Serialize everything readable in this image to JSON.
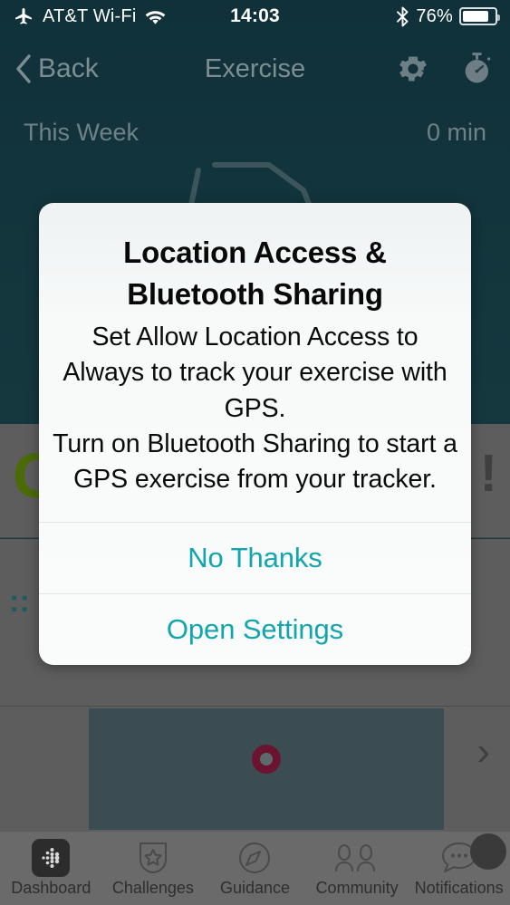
{
  "statusbar": {
    "airplane_icon": "airplane-icon",
    "carrier": "AT&T Wi-Fi",
    "wifi_icon": "wifi-icon",
    "time": "14:03",
    "bluetooth_icon": "bluetooth-icon",
    "battery_percent": "76%",
    "battery_icon": "battery-icon"
  },
  "navbar": {
    "back_label": "Back",
    "back_icon": "chevron-left-icon",
    "title": "Exercise",
    "settings_icon": "gear-icon",
    "stopwatch_icon": "stopwatch-icon"
  },
  "summary": {
    "period_label": "This Week",
    "duration_value": "0 min"
  },
  "background": {
    "green_glyph": "G",
    "exclamation": "!",
    "teal_fragment": "::",
    "chevron": "›",
    "record_icon": "record-button-icon",
    "shoe_icon": "running-shoe-icon"
  },
  "dialog": {
    "title": "Location Access & Bluetooth Sharing",
    "message": "Set Allow Location Access to Always to track your exercise with GPS.\nTurn on Bluetooth Sharing to start a GPS exercise from your tracker.",
    "primary_label": "Open Settings",
    "secondary_label": "No Thanks",
    "accent_color": "#12a5ad"
  },
  "tabbar": {
    "items": [
      {
        "label": "Dashboard",
        "icon": "fitbit-dots-icon"
      },
      {
        "label": "Challenges",
        "icon": "shield-star-icon"
      },
      {
        "label": "Guidance",
        "icon": "compass-icon"
      },
      {
        "label": "Community",
        "icon": "people-icon"
      },
      {
        "label": "Notifications",
        "icon": "speech-bubble-icon"
      }
    ]
  },
  "theme": {
    "app_background": "#12333c",
    "dimmed_overlay": "#5d5d5d",
    "panel": "#3c4c53",
    "record_ring": "#6b1430"
  }
}
